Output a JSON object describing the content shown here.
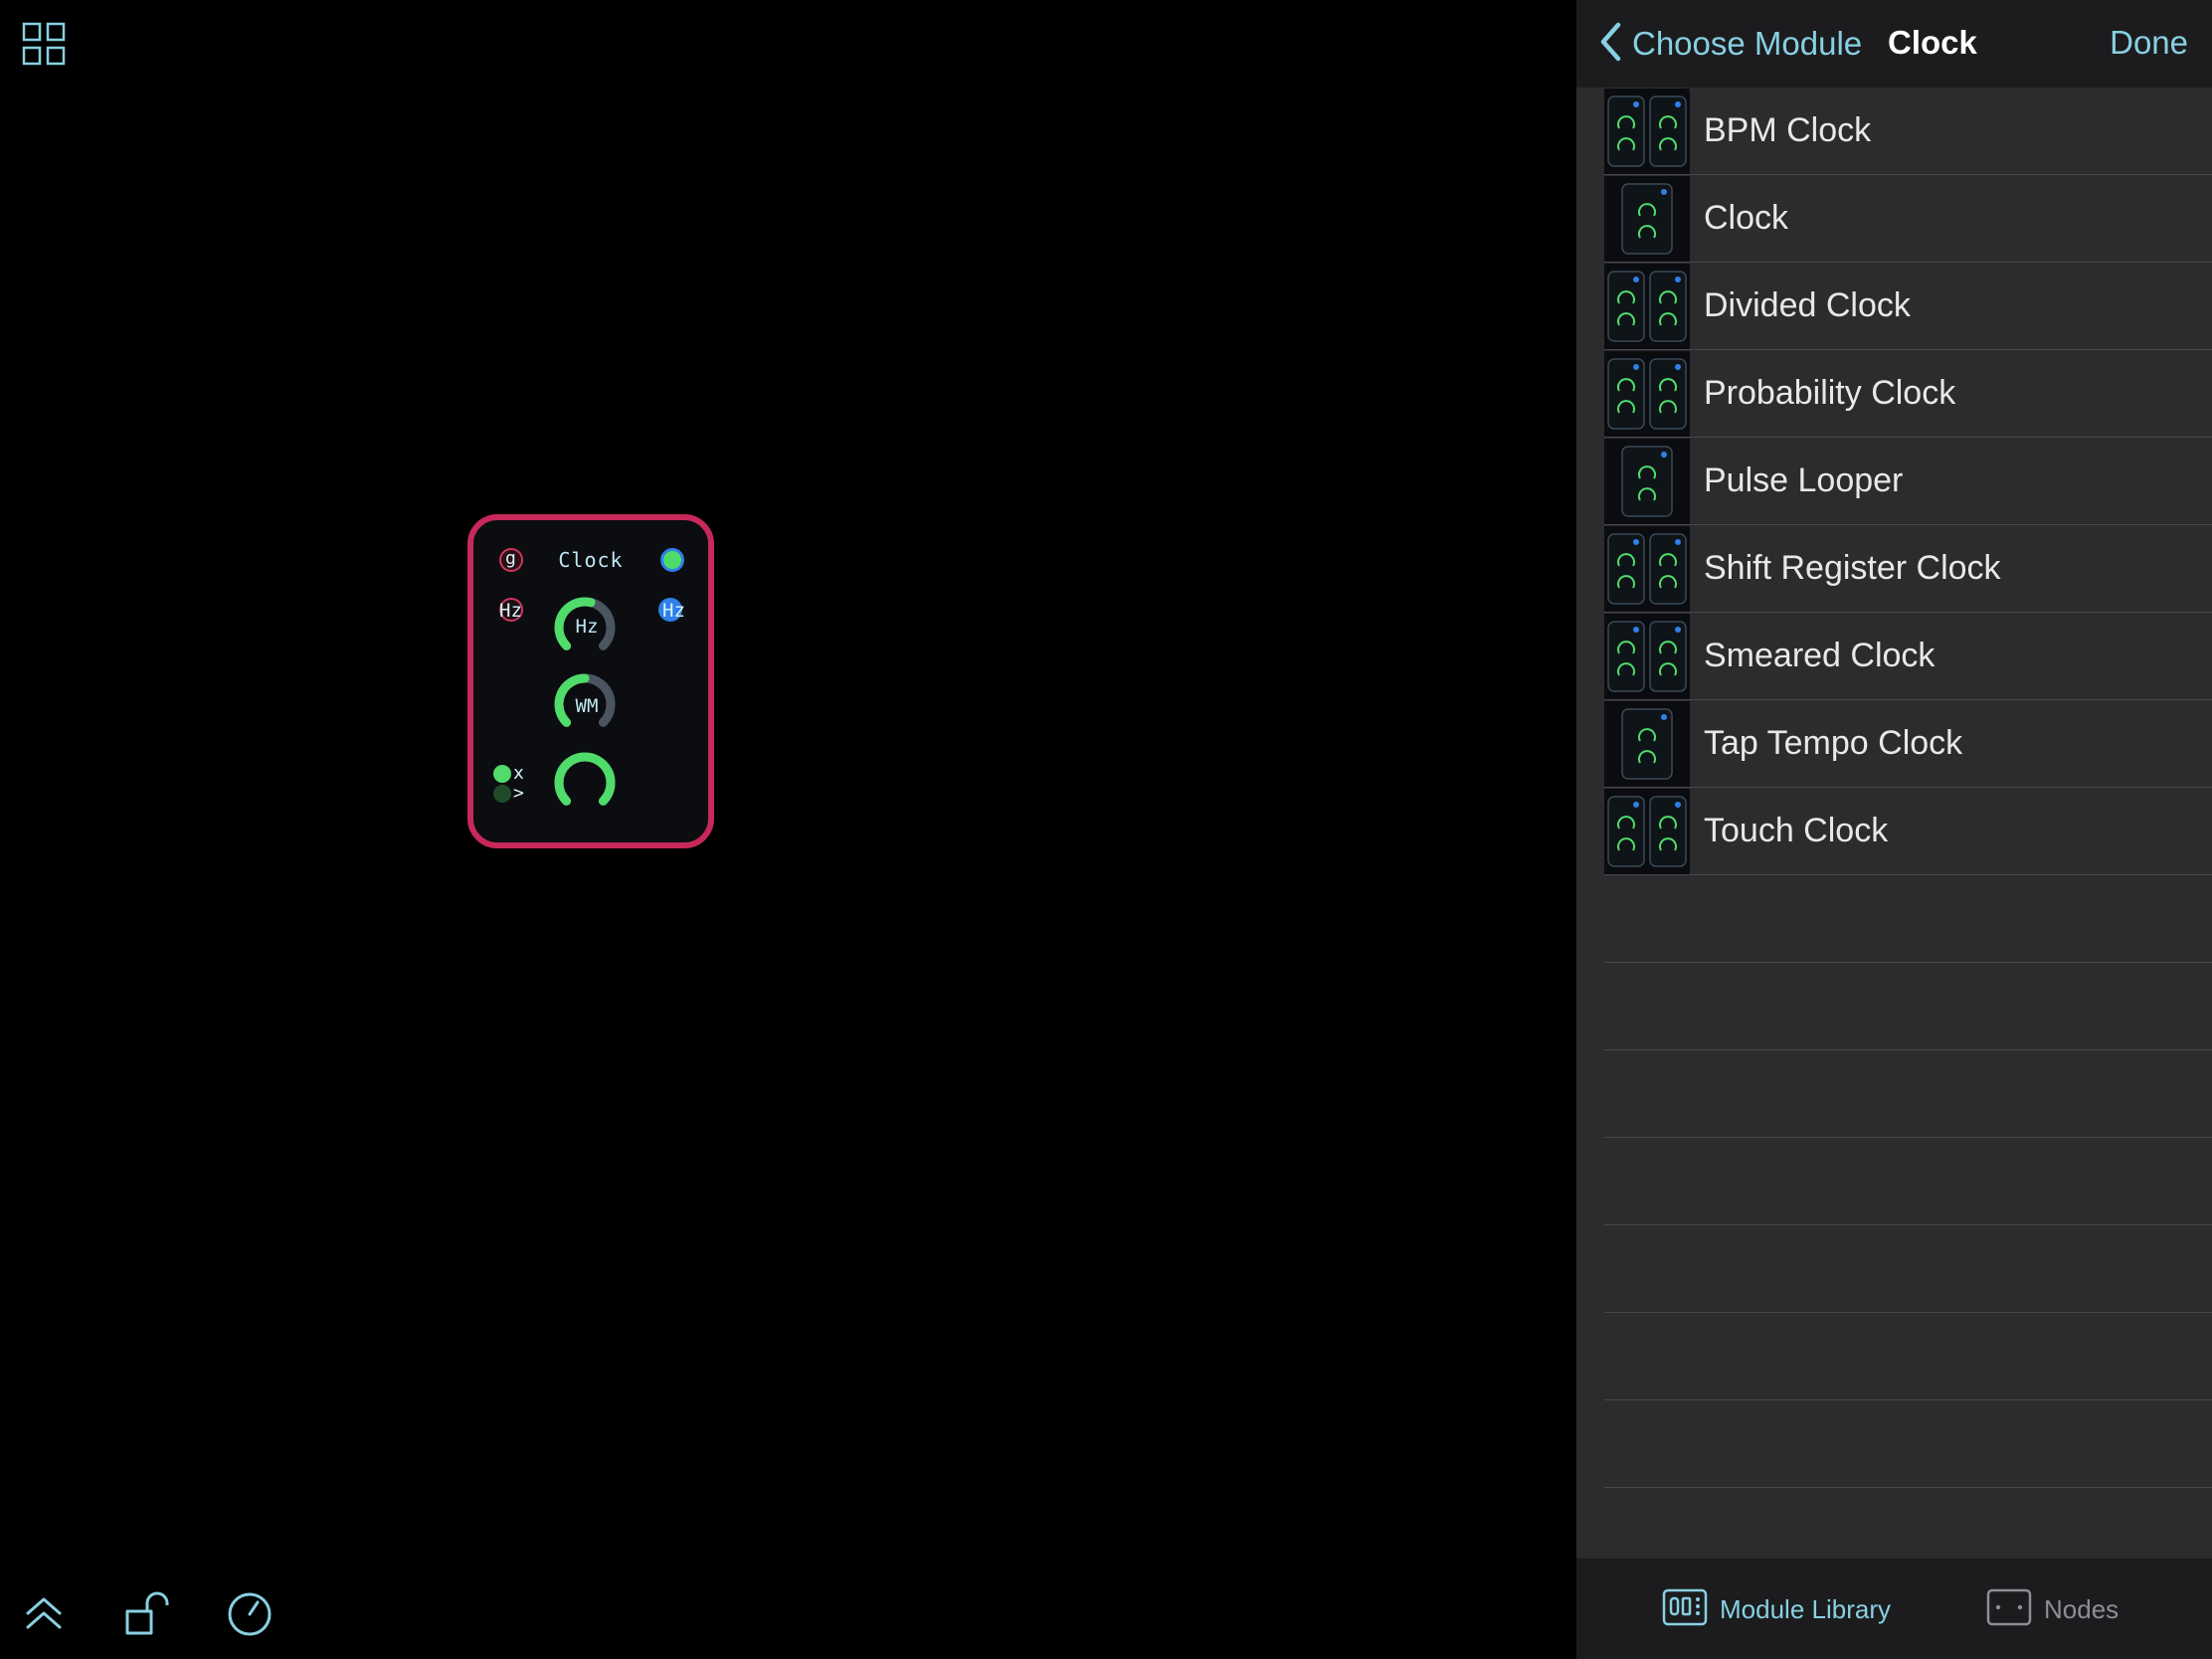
{
  "canvas": {
    "icons": {
      "grid": "grid-icon",
      "collapse": "chevron-up-double-icon",
      "lock": "unlock-icon",
      "clock": "clock-icon"
    },
    "module": {
      "title": "Clock",
      "port_left_top": "g",
      "port_left_mid": "Hz",
      "port_right_mid": "Hz",
      "knob1_label": "Hz",
      "knob2_label": "WM",
      "led1_label": "x",
      "led2_label": ">",
      "border_color": "#c8285a",
      "knob1_value": 0.55,
      "knob2_value": 0.5,
      "knob3_value": 1.0
    }
  },
  "nav": {
    "back_label": "Choose Module",
    "title": "Clock",
    "done_label": "Done"
  },
  "list": {
    "items": [
      {
        "label": "BPM Clock",
        "thumb": "bpm-clock-thumbnail"
      },
      {
        "label": "Clock",
        "thumb": "clock-thumbnail"
      },
      {
        "label": "Divided Clock",
        "thumb": "divided-clock-thumbnail"
      },
      {
        "label": "Probability Clock",
        "thumb": "probability-clock-thumbnail"
      },
      {
        "label": "Pulse Looper",
        "thumb": "pulse-looper-thumbnail"
      },
      {
        "label": "Shift Register Clock",
        "thumb": "shift-register-clock-thumbnail"
      },
      {
        "label": "Smeared Clock",
        "thumb": "smeared-clock-thumbnail"
      },
      {
        "label": "Tap Tempo Clock",
        "thumb": "tap-tempo-clock-thumbnail"
      },
      {
        "label": "Touch Clock",
        "thumb": "touch-clock-thumbnail"
      }
    ],
    "empty_rows": 8
  },
  "tabbar": {
    "module_library_label": "Module Library",
    "nodes_label": "Nodes",
    "active_color": "#88d0e2",
    "inactive_color": "#8e8e93"
  },
  "colors": {
    "accent": "#88d0e2",
    "knob_active": "#4fdc6a",
    "knob_track": "#4a5560",
    "port_blue": "#2f7fe8",
    "panel_bg": "#2c2c2e"
  }
}
